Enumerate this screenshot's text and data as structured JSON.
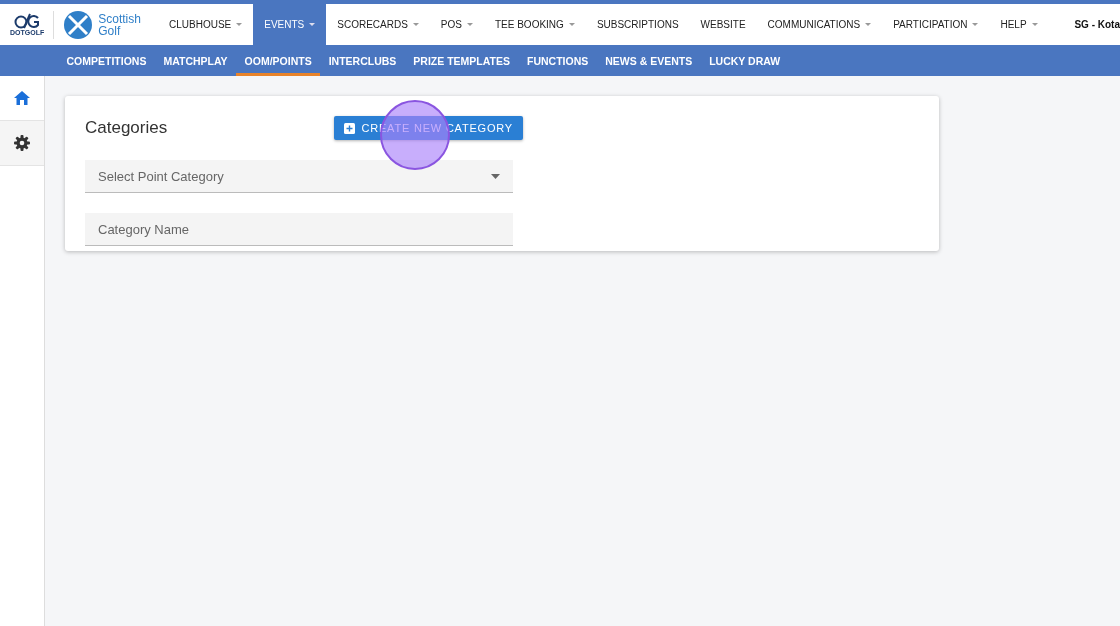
{
  "brand": {
    "dotgolf": "DOTGOLF",
    "partner": "Scottish Golf"
  },
  "nav": [
    {
      "label": "CLUBHOUSE",
      "has_menu": true,
      "selected": false
    },
    {
      "label": "EVENTS",
      "has_menu": true,
      "selected": true
    },
    {
      "label": "SCORECARDS",
      "has_menu": true,
      "selected": false
    },
    {
      "label": "POS",
      "has_menu": true,
      "selected": false
    },
    {
      "label": "TEE BOOKING",
      "has_menu": true,
      "selected": false
    },
    {
      "label": "SUBSCRIPTIONS",
      "has_menu": false,
      "selected": false
    },
    {
      "label": "WEBSITE",
      "has_menu": false,
      "selected": false
    },
    {
      "label": "COMMUNICATIONS",
      "has_menu": true,
      "selected": false
    },
    {
      "label": "PARTICIPATION",
      "has_menu": true,
      "selected": false
    },
    {
      "label": "HELP",
      "has_menu": true,
      "selected": false
    }
  ],
  "user": "SG - Kota",
  "subnav": [
    {
      "label": "COMPETITIONS",
      "selected": false
    },
    {
      "label": "MATCHPLAY",
      "selected": false
    },
    {
      "label": "OOM/POINTS",
      "selected": true
    },
    {
      "label": "INTERCLUBS",
      "selected": false
    },
    {
      "label": "PRIZE TEMPLATES",
      "selected": false
    },
    {
      "label": "FUNCTIONS",
      "selected": false
    },
    {
      "label": "NEWS & EVENTS",
      "selected": false
    },
    {
      "label": "LUCKY DRAW",
      "selected": false
    }
  ],
  "sidebar": [
    {
      "kind": "home",
      "selected": true
    },
    {
      "kind": "settings",
      "selected": false
    }
  ],
  "card": {
    "title": "Categories",
    "create_button": "CREATE NEW CATEGORY",
    "select": {
      "placeholder": "Select Point Category"
    },
    "name_field": {
      "placeholder": "Category Name"
    }
  }
}
